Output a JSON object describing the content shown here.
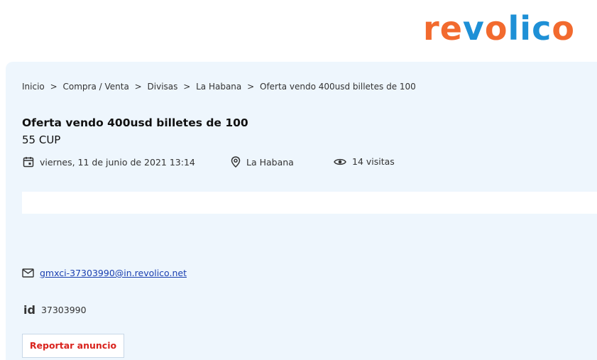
{
  "logo": {
    "text": "revolico",
    "colors": {
      "orange": "#f26a2e",
      "blue": "#1e90d6"
    }
  },
  "breadcrumb": [
    {
      "label": "Inicio"
    },
    {
      "label": ">"
    },
    {
      "label": "Compra / Venta"
    },
    {
      "label": ">"
    },
    {
      "label": "Divisas"
    },
    {
      "label": ">"
    },
    {
      "label": "La Habana"
    },
    {
      "label": ">"
    },
    {
      "label": " Oferta vendo 400usd billetes de 100"
    }
  ],
  "ad": {
    "title": "Oferta vendo 400usd billetes de 100",
    "price": "55 CUP",
    "date": "viernes, 11 de junio de 2021 13:14",
    "location": "La Habana",
    "visits": "14 visitas",
    "email": "gmxci-37303990@in.revolico.net",
    "id_icon": "id",
    "id": "37303990",
    "report_label": "Reportar anuncio"
  },
  "icons": {
    "date": "calendar-icon",
    "location": "location-pin-icon",
    "visits": "eye-icon",
    "email": "mail-icon",
    "id": "id-icon"
  }
}
